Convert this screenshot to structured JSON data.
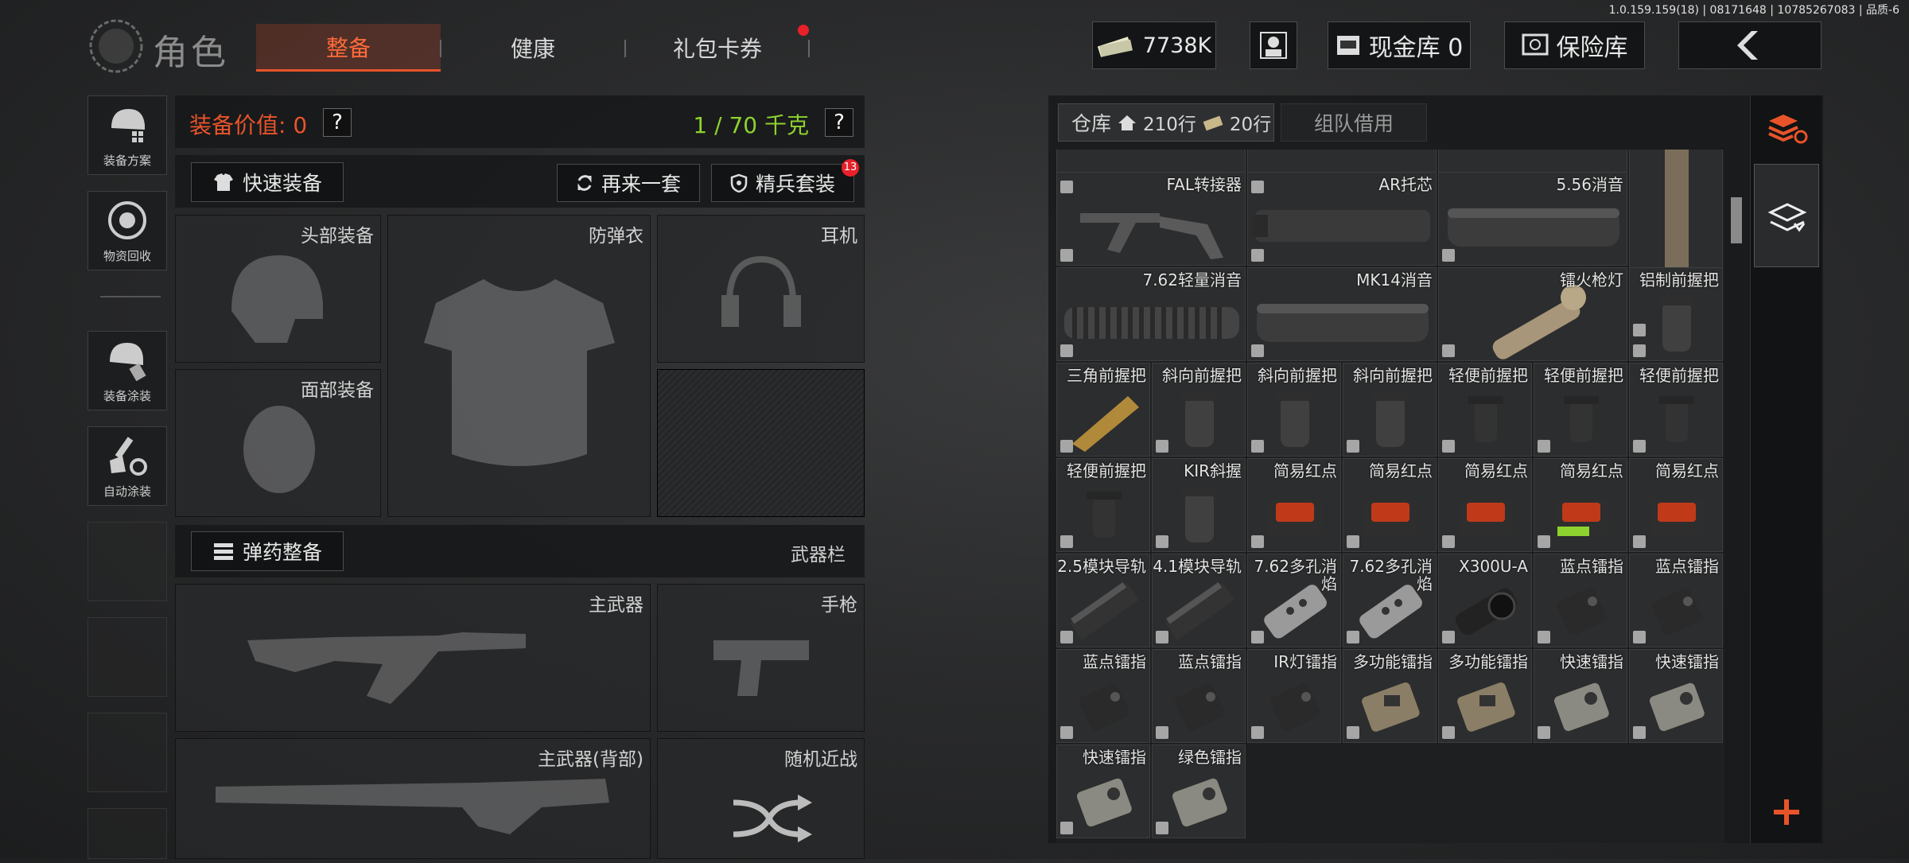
{
  "build_info": "1.0.159.159(18) | 08171648 | 10785267083 | 品质-6",
  "header": {
    "title": "角色",
    "tabs": [
      {
        "label": "整备",
        "active": true
      },
      {
        "label": "健康",
        "active": false
      },
      {
        "label": "礼包卡券",
        "active": false,
        "notification": true
      }
    ],
    "currency": "7738K",
    "cash_vault": "现金库 0",
    "safe_box": "保险库"
  },
  "sidebar": [
    {
      "label": "装备方案",
      "icon": "helmet-grid-icon"
    },
    {
      "label": "物资回收",
      "icon": "recycle-icon"
    },
    {
      "label": "装备涂装",
      "icon": "helmet-paint-icon"
    },
    {
      "label": "自动涂装",
      "icon": "brush-gear-icon"
    }
  ],
  "loadout": {
    "value_label": "装备价值: 0",
    "weight_label": "1 / 70 千克",
    "help": "?",
    "quick_equip": "快速装备",
    "reroll": "再来一套",
    "elite_kit": "精兵套装",
    "elite_badge": "13",
    "slots": {
      "head": "头部装备",
      "armor": "防弹衣",
      "headset": "耳机",
      "face": "面部装备"
    },
    "ammo_button": "弹药整备",
    "weapon_bar": "武器栏",
    "primary": "主武器",
    "pistol": "手枪",
    "primary_back": "主武器(背部)",
    "melee": "随机近战"
  },
  "storage": {
    "tab_warehouse": "仓库",
    "rows_home": "210行",
    "rows_extra": "20行",
    "tab_team": "组队借用",
    "items_big": [
      {
        "name": "FAL转接器",
        "type": "stock"
      },
      {
        "name": "AR托芯",
        "type": "tube"
      },
      {
        "name": "5.56消音",
        "type": "suppressor"
      },
      {
        "name": "7.62轻量消音",
        "type": "suppressor-ribbed"
      },
      {
        "name": "MK14消音",
        "type": "suppressor"
      },
      {
        "name": "镭火枪灯",
        "type": "flashlight"
      }
    ],
    "items_small": [
      {
        "name": "铝制前握把",
        "row": 1,
        "col": 6,
        "type": "grip"
      },
      {
        "name": "三角前握把",
        "row": 2,
        "col": 0,
        "type": "grip-tan"
      },
      {
        "name": "斜向前握把",
        "row": 2,
        "col": 1,
        "type": "grip"
      },
      {
        "name": "斜向前握把",
        "row": 2,
        "col": 2,
        "type": "grip"
      },
      {
        "name": "斜向前握把",
        "row": 2,
        "col": 3,
        "type": "grip"
      },
      {
        "name": "轻便前握把",
        "row": 2,
        "col": 4,
        "type": "grip-small"
      },
      {
        "name": "轻便前握把",
        "row": 2,
        "col": 5,
        "type": "grip-small"
      },
      {
        "name": "轻便前握把",
        "row": 2,
        "col": 6,
        "type": "grip-small"
      },
      {
        "name": "轻便前握把",
        "row": 3,
        "col": 0,
        "type": "grip-small"
      },
      {
        "name": "KIR斜握",
        "row": 3,
        "col": 1,
        "type": "grip"
      },
      {
        "name": "简易红点",
        "row": 3,
        "col": 2,
        "type": "reddot"
      },
      {
        "name": "简易红点",
        "row": 3,
        "col": 3,
        "type": "reddot"
      },
      {
        "name": "简易红点",
        "row": 3,
        "col": 4,
        "type": "reddot"
      },
      {
        "name": "简易红点",
        "row": 3,
        "col": 5,
        "type": "reddot-green"
      },
      {
        "name": "简易红点",
        "row": 3,
        "col": 6,
        "type": "reddot"
      },
      {
        "name": "2.5模块导轨",
        "row": 4,
        "col": 0,
        "type": "rail"
      },
      {
        "name": "4.1模块导轨",
        "row": 4,
        "col": 1,
        "type": "rail"
      },
      {
        "name": "7.62多孔消焰",
        "row": 4,
        "col": 2,
        "type": "brake"
      },
      {
        "name": "7.62多孔消焰",
        "row": 4,
        "col": 3,
        "type": "brake"
      },
      {
        "name": "X300U-A",
        "row": 4,
        "col": 4,
        "type": "light"
      },
      {
        "name": "蓝点镭指",
        "row": 4,
        "col": 5,
        "type": "laser"
      },
      {
        "name": "蓝点镭指",
        "row": 4,
        "col": 6,
        "type": "laser"
      },
      {
        "name": "蓝点镭指",
        "row": 5,
        "col": 0,
        "type": "laser"
      },
      {
        "name": "蓝点镭指",
        "row": 5,
        "col": 1,
        "type": "laser"
      },
      {
        "name": "IR灯镭指",
        "row": 5,
        "col": 2,
        "type": "laser"
      },
      {
        "name": "多功能镭指",
        "row": 5,
        "col": 3,
        "type": "peq"
      },
      {
        "name": "多功能镭指",
        "row": 5,
        "col": 4,
        "type": "peq"
      },
      {
        "name": "快速镭指",
        "row": 5,
        "col": 5,
        "type": "laser-grey"
      },
      {
        "name": "快速镭指",
        "row": 5,
        "col": 6,
        "type": "laser-grey"
      },
      {
        "name": "快速镭指",
        "row": 6,
        "col": 0,
        "type": "laser-grey"
      },
      {
        "name": "绿色镭指",
        "row": 6,
        "col": 1,
        "type": "laser-grey"
      }
    ]
  },
  "colors": {
    "accent": "#e8542a",
    "weight_green": "#8ed22f",
    "notify_red": "#e8202a"
  }
}
